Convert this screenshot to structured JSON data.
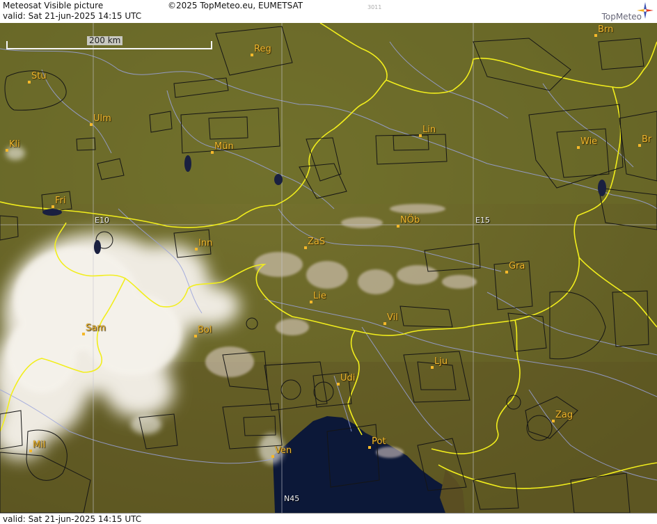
{
  "header": {
    "title": "Meteosat Visible picture",
    "copyright": "©2025 TopMeteo.eu, EUMETSAT",
    "code": "3011",
    "valid": "valid:  Sat  21-jun-2025  14:15 UTC",
    "logo": "TopMeteo"
  },
  "footer": {
    "valid": "valid:  Sat  21-jun-2025  14:15 UTC"
  },
  "scale_bar": {
    "label": "200 km"
  },
  "grid_labels": {
    "e10": "E10",
    "e15": "E15",
    "n45": "N45"
  },
  "cities": [
    {
      "id": "reg",
      "label": "Reg"
    },
    {
      "id": "brn",
      "label": "Brn"
    },
    {
      "id": "stu",
      "label": "Stu"
    },
    {
      "id": "ulm",
      "label": "Ulm"
    },
    {
      "id": "mun",
      "label": "Mün"
    },
    {
      "id": "lin",
      "label": "Lin"
    },
    {
      "id": "wie",
      "label": "Wie"
    },
    {
      "id": "br",
      "label": "Br"
    },
    {
      "id": "kli",
      "label": "Kli"
    },
    {
      "id": "fri",
      "label": "Fri"
    },
    {
      "id": "nob",
      "label": "NÖb"
    },
    {
      "id": "inn",
      "label": "Inn"
    },
    {
      "id": "zas",
      "label": "ZaS"
    },
    {
      "id": "gra",
      "label": "Gra"
    },
    {
      "id": "lie",
      "label": "Lie"
    },
    {
      "id": "vil",
      "label": "Vil"
    },
    {
      "id": "sam",
      "label": "Sam"
    },
    {
      "id": "bol",
      "label": "Bol"
    },
    {
      "id": "lju",
      "label": "Lju"
    },
    {
      "id": "udi",
      "label": "Udi"
    },
    {
      "id": "zag",
      "label": "Zag"
    },
    {
      "id": "mil",
      "label": "Mil"
    },
    {
      "id": "ven",
      "label": "Ven"
    },
    {
      "id": "pot",
      "label": "Pot"
    }
  ],
  "colors": {
    "land": "#6b6a2a",
    "sea": "#0d1a40",
    "border": "#f0ec1e",
    "river": "#9ea6e0",
    "airspace": "#1a1a1a",
    "city": "#f0b830",
    "cloud": "#eeeae0"
  }
}
